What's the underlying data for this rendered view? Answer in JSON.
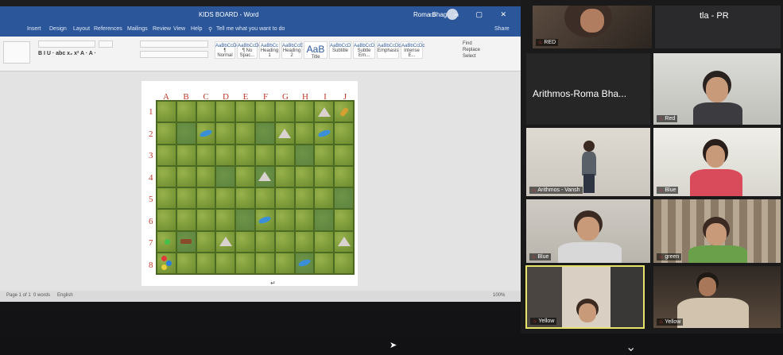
{
  "word": {
    "title": "KIDS BOARD - Word",
    "user": "Roma Bhagwan",
    "menu": [
      "Insert",
      "Design",
      "Layout",
      "References",
      "Mailings",
      "Review",
      "View",
      "Help"
    ],
    "tell_me": "Tell me what you want to do",
    "share": "Share",
    "styles": [
      "AaBbCcDc",
      "AaBbCcDc",
      "AaBbCc",
      "AaBbCcE",
      "AaB",
      "AaBbCcD",
      "AaBbCcD",
      "AaBbCcDc",
      "AaBbCcDc"
    ],
    "style_names": [
      "¶ Normal",
      "¶ No Spac...",
      "Heading 1",
      "Heading 2",
      "Title",
      "Subtitle",
      "Subtle Em...",
      "Emphasis",
      "Intense E..."
    ],
    "editing": [
      "Find",
      "Replace",
      "Select"
    ],
    "status": [
      "Page 1 of 1",
      "0 words",
      "English"
    ],
    "zoom": "100%"
  },
  "board": {
    "columns": [
      "A",
      "B",
      "C",
      "D",
      "E",
      "F",
      "G",
      "H",
      "I",
      "J"
    ],
    "rows": [
      "1",
      "2",
      "3",
      "4",
      "5",
      "6",
      "7",
      "8"
    ]
  },
  "zoom": {
    "top_name": "tla - PR",
    "tiles": [
      {
        "label": "RED"
      },
      {
        "label": "",
        "big": "Arithmos-Roma Bha..."
      },
      {
        "label": "Red"
      },
      {
        "label": "Arithmos - Vansh"
      },
      {
        "label": "Blue"
      },
      {
        "label": "Blue"
      },
      {
        "label": "green"
      },
      {
        "label": "Yellow"
      },
      {
        "label": "Yellow"
      }
    ]
  }
}
